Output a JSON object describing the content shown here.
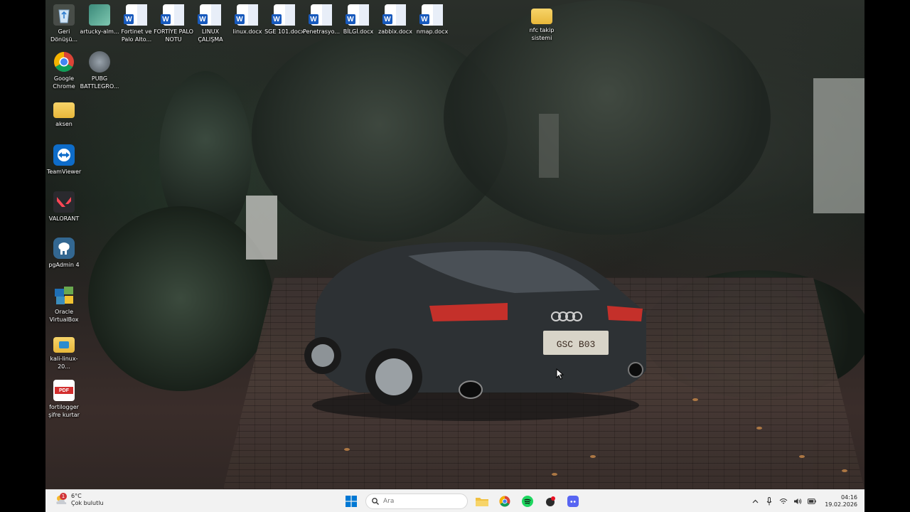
{
  "desktop": {
    "icons": [
      {
        "label": "Geri Dönüşü..."
      },
      {
        "label": "artucky-alm..."
      },
      {
        "label": "Fortinet ve Palo Alto..."
      },
      {
        "label": "FORTİYE PALO NOTU"
      },
      {
        "label": "LINUX ÇALIŞMA"
      },
      {
        "label": "linux.docx"
      },
      {
        "label": "SGE 101.docx"
      },
      {
        "label": "Penetrasyo..."
      },
      {
        "label": "BİLGİ.docx"
      },
      {
        "label": "zabbix.docx"
      },
      {
        "label": "nmap.docx"
      },
      {
        "label": "nfc takip sistemi"
      },
      {
        "label": "Google Chrome"
      },
      {
        "label": "PUBG BATTLEGRO..."
      },
      {
        "label": "aksen"
      },
      {
        "label": "TeamViewer"
      },
      {
        "label": "VALORANT"
      },
      {
        "label": "pgAdmin 4"
      },
      {
        "label": "Oracle VirtualBox"
      },
      {
        "label": "kali-linux-20..."
      },
      {
        "label": "fortilogger şifre kurtar"
      }
    ],
    "pdf_badge": "PDF",
    "word_letter": "W",
    "car_plate": "GSC B03"
  },
  "taskbar": {
    "weather_temp": "6°C",
    "weather_desc": "Çok bulutlu",
    "weather_badge": "1",
    "search_placeholder": "Ara",
    "time": "04:16",
    "date": "19.02.2026"
  },
  "colors": {
    "taskbar_bg": "#f2f2f2",
    "windows_blue": "#0078d4",
    "word_blue": "#185abd"
  }
}
